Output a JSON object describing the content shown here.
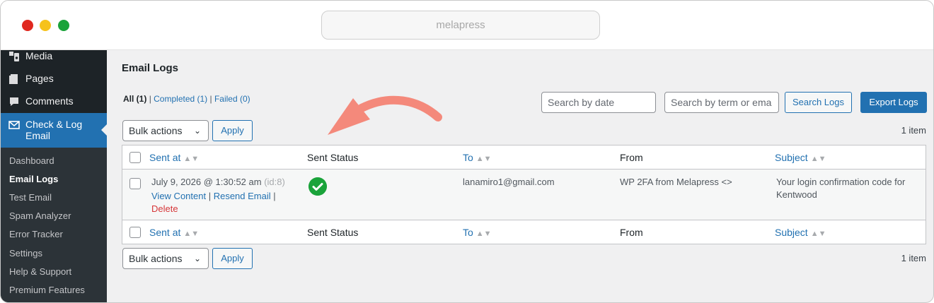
{
  "browser": {
    "url": "melapress"
  },
  "sidebar": {
    "items": [
      {
        "label": "Media",
        "icon": "media-icon"
      },
      {
        "label": "Pages",
        "icon": "pages-icon"
      },
      {
        "label": "Comments",
        "icon": "comments-icon"
      },
      {
        "label": "Check & Log Email",
        "icon": "email-icon"
      }
    ],
    "submenu": [
      "Dashboard",
      "Email Logs",
      "Test Email",
      "Spam Analyzer",
      "Error Tracker",
      "Settings",
      "Help & Support",
      "Premium Features"
    ],
    "current": "Email Logs"
  },
  "page": {
    "title": "Email Logs",
    "filters": {
      "all": "All (1)",
      "completed": "Completed (1)",
      "failed": "Failed (0)"
    },
    "search_date_placeholder": "Search by date",
    "search_term_placeholder": "Search by term or ema",
    "search_button": "Search Logs",
    "export_button": "Export Logs",
    "bulk_actions": "Bulk actions",
    "apply": "Apply",
    "item_count": "1 item"
  },
  "table": {
    "columns": {
      "sent_at": "Sent at",
      "status": "Sent Status",
      "to": "To",
      "from": "From",
      "subject": "Subject"
    },
    "rows": [
      {
        "sent_at": "July 9, 2026 @ 1:30:52 am",
        "id": "(id:8)",
        "actions": {
          "view": "View Content",
          "resend": "Resend Email",
          "delete": "Delete"
        },
        "status": "success",
        "to": "lanamiro1@gmail.com",
        "from": "WP 2FA from Melapress <>",
        "subject_line1": "Your login confirmation code for",
        "subject_line2": "Kentwood"
      }
    ]
  },
  "colors": {
    "accent": "#2271b1",
    "sidebar_bg": "#1d2327",
    "success": "#1aa33a",
    "annotation_arrow": "#f4897b"
  }
}
